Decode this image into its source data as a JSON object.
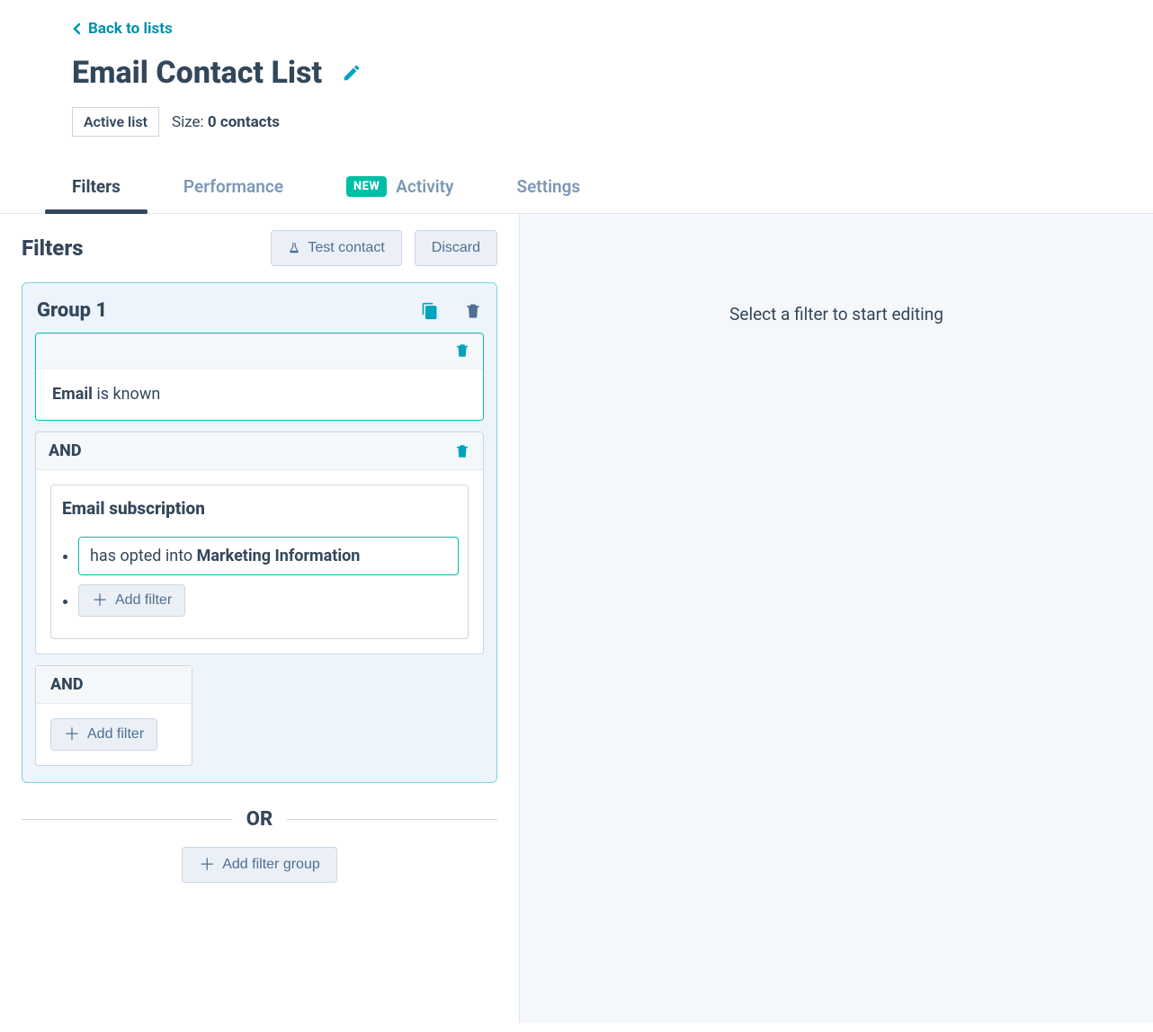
{
  "header": {
    "back_label": "Back to lists",
    "title": "Email Contact List",
    "status_badge": "Active list",
    "size_prefix": "Size: ",
    "size_value": "0 contacts"
  },
  "tabs": {
    "filters": "Filters",
    "performance": "Performance",
    "new_badge": "NEW",
    "activity": "Activity",
    "settings": "Settings"
  },
  "panel": {
    "title": "Filters",
    "test_contact": "Test contact",
    "discard": "Discard"
  },
  "group": {
    "title": "Group 1",
    "rule1_property": "Email",
    "rule1_condition": " is known",
    "and_label": "AND",
    "rule2_title": "Email subscription",
    "rule2_prefix": "has opted into ",
    "rule2_bold": "Marketing Information",
    "add_filter": "Add filter"
  },
  "or_label": "OR",
  "add_group": "Add filter group",
  "right_panel_text": "Select a filter to start editing"
}
